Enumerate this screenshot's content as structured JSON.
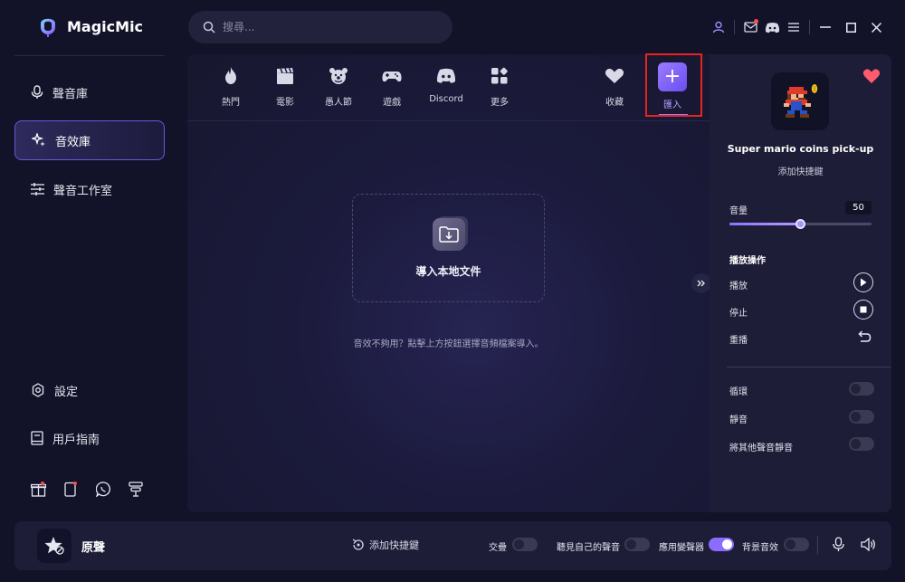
{
  "app": {
    "name": "MagicMic"
  },
  "search": {
    "placeholder": "搜尋..."
  },
  "sidebar": {
    "items": [
      {
        "label": "聲音庫",
        "icon": "mic-icon"
      },
      {
        "label": "音效庫",
        "icon": "sparkle-icon",
        "active": true
      },
      {
        "label": "聲音工作室",
        "icon": "sliders-icon"
      }
    ],
    "bottom": [
      {
        "label": "設定",
        "icon": "gear-icon"
      },
      {
        "label": "用戶指南",
        "icon": "book-icon"
      }
    ],
    "icons": [
      "gift-icon",
      "tablet-icon",
      "whatsapp-icon",
      "stack-icon"
    ]
  },
  "categories": [
    {
      "label": "熱門",
      "icon": "flame-icon"
    },
    {
      "label": "電影",
      "icon": "clapper-icon"
    },
    {
      "label": "愚人節",
      "icon": "clown-icon"
    },
    {
      "label": "遊戲",
      "icon": "gamepad-icon"
    },
    {
      "label": "Discord",
      "icon": "discord-icon"
    },
    {
      "label": "更多",
      "icon": "grid-icon"
    },
    {
      "label": "收藏",
      "icon": "heart-icon"
    },
    {
      "label": "匯入",
      "icon": "plus-icon",
      "selected": true
    }
  ],
  "main": {
    "dropzone_label": "導入本地文件",
    "hint": "音效不夠用？點擊上方按鈕選擇音頻檔案導入。"
  },
  "right_panel": {
    "sound_title": "Super mario coins pick-up",
    "add_shortcut": "添加快捷鍵",
    "volume_label": "音量",
    "volume_value": "50",
    "volume_fraction": 0.5,
    "section_title": "播放操作",
    "play": "播放",
    "stop": "停止",
    "replay": "重播",
    "loop": "循環",
    "mute": "靜音",
    "mute_others": "將其他聲音靜音"
  },
  "bottom_bar": {
    "voice_name": "原聲",
    "add_shortcut": "添加快捷鍵",
    "overlap": "交疊",
    "hear_self": "聽見自己的聲音",
    "apply_changer": "應用變聲器",
    "bg_effect": "背景音效"
  },
  "colors": {
    "accent": "#8b6cff",
    "highlight_box": "#e8231e",
    "background": "#121229"
  }
}
